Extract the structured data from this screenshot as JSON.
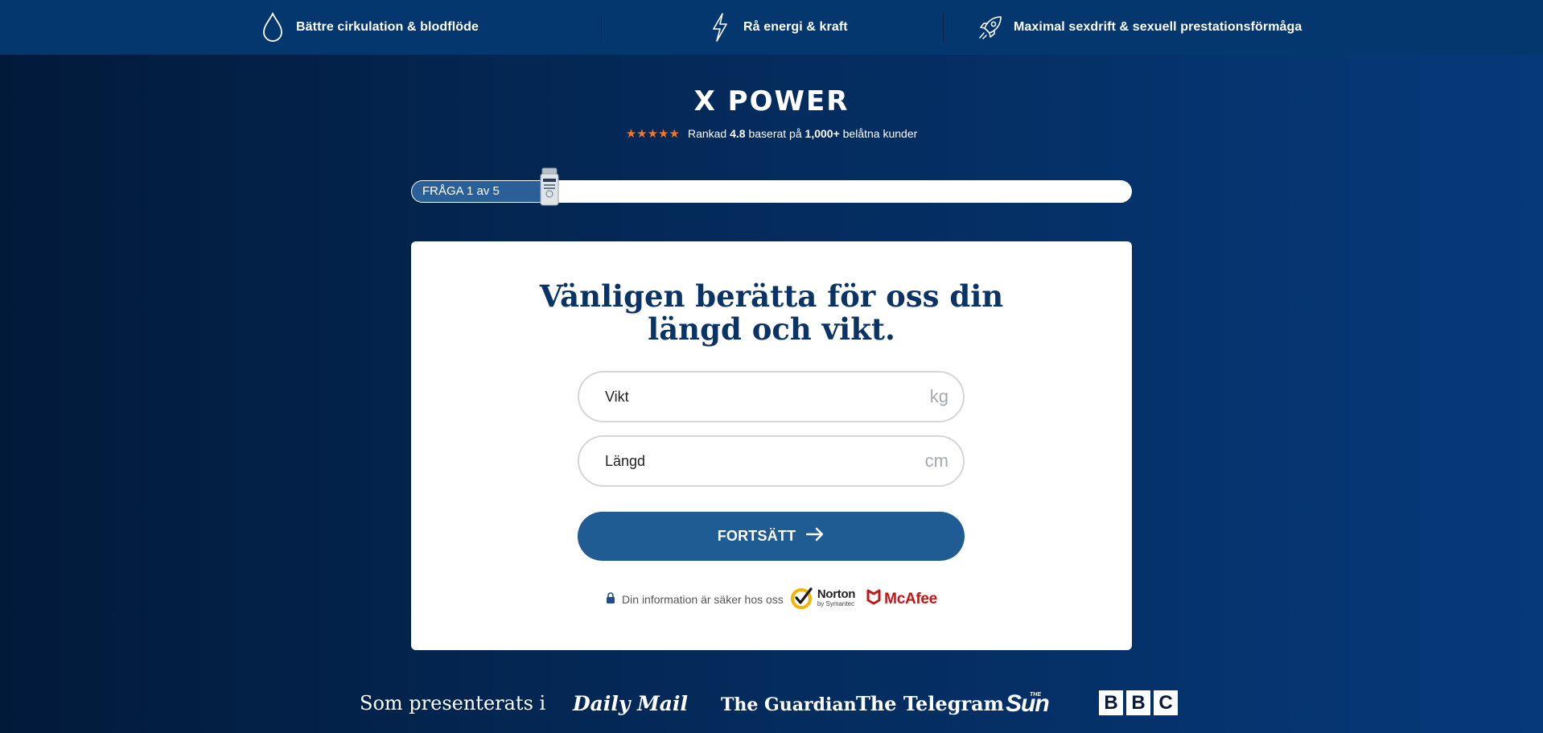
{
  "benefits": [
    {
      "label": "Bättre cirkulation & blodflöde",
      "icon": "droplet-icon"
    },
    {
      "label": "Rå energi & kraft",
      "icon": "lightning-icon"
    },
    {
      "label": "Maximal sexdrift & sexuell prestationsförmåga",
      "icon": "rocket-icon"
    }
  ],
  "brand": "X POWER",
  "rating": {
    "stars": "★★★★★",
    "prefix": "Rankad",
    "score": "4.8",
    "middle": "baserat på",
    "count": "1,000+",
    "suffix": "belåtna kunder"
  },
  "progress": {
    "label": "FRÅGA 1 av 5",
    "current": 1,
    "total": 5
  },
  "question": {
    "line1": "Vänligen berätta för oss din",
    "line2": "längd och vikt."
  },
  "fields": {
    "weight": {
      "placeholder": "Vikt",
      "unit": "kg"
    },
    "height": {
      "placeholder": "Längd",
      "unit": "cm"
    }
  },
  "continue_label": "FORTSÄTT",
  "secure_text": "Din information är säker hos oss",
  "badges": {
    "norton": "Norton",
    "norton_sub": "by Symantec",
    "mcafee": "McAfee"
  },
  "featured": {
    "lead": "Som presenterats i",
    "outlets": [
      "Daily Mail",
      "The Guardian",
      "The Telegram",
      "Sun",
      "BBC"
    ],
    "sun_small": "THE",
    "bbc_letters": [
      "B",
      "B",
      "C"
    ]
  },
  "colors": {
    "accent": "#1f5c94",
    "brand_navy": "#0a3466",
    "star": "#f0772a",
    "mcafee_red": "#c01818"
  }
}
